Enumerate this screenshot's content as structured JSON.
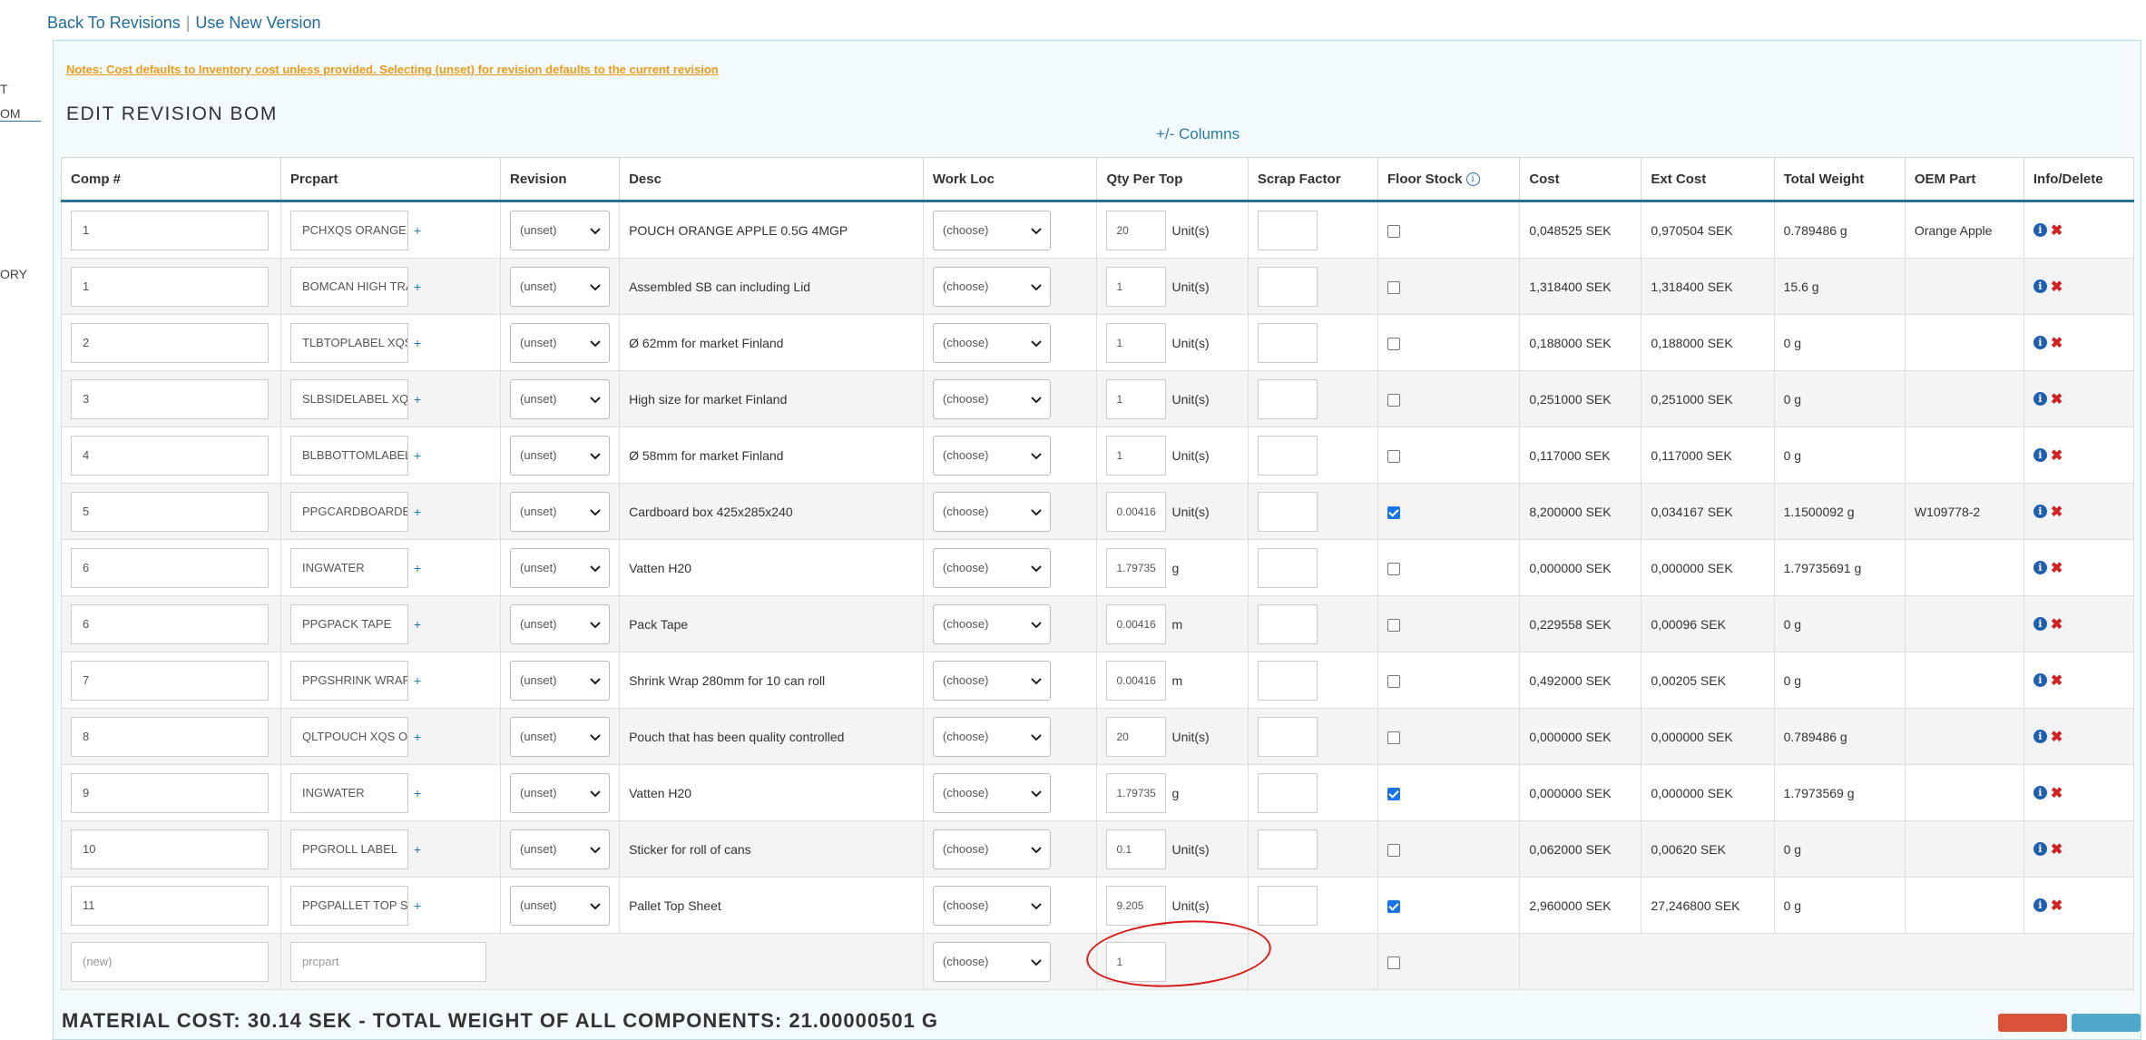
{
  "sidebar": {
    "fragments": [
      "T",
      "OM",
      "ORY"
    ]
  },
  "links": {
    "back": "Back To Revisions",
    "separator": "|",
    "use_new": "Use New Version"
  },
  "notes": "Notes: Cost defaults to Inventory cost unless provided. Selecting (unset) for revision defaults to the current revision",
  "title": "EDIT REVISION BOM",
  "columns_toggle": "+/- Columns",
  "headers": {
    "comp": "Comp #",
    "prcpart": "Prcpart",
    "revision": "Revision",
    "desc": "Desc",
    "workloc": "Work Loc",
    "qty": "Qty Per Top",
    "scrap": "Scrap Factor",
    "floor": "Floor Stock",
    "cost": "Cost",
    "extcost": "Ext Cost",
    "weight": "Total Weight",
    "oem": "OEM Part",
    "info": "Info/Delete"
  },
  "rows": [
    {
      "comp": "1",
      "prcpart": "PCHXQS ORANGE APPLE",
      "revision": "(unset)",
      "desc": "POUCH ORANGE APPLE 0.5G 4MGP",
      "workloc": "(choose)",
      "qty": "20",
      "unit": "Unit(s)",
      "floor": false,
      "cost": "0,048525 SEK",
      "extcost": "0,970504 SEK",
      "weight": "0.789486 g",
      "oem": "Orange Apple"
    },
    {
      "comp": "1",
      "prcpart": "BOMCAN HIGH TRAY",
      "revision": "(unset)",
      "desc": "Assembled SB can including Lid",
      "workloc": "(choose)",
      "qty": "1",
      "unit": "Unit(s)",
      "floor": false,
      "cost": "1,318400 SEK",
      "extcost": "1,318400 SEK",
      "weight": "15.6 g",
      "oem": ""
    },
    {
      "comp": "2",
      "prcpart": "TLBTOPLABEL XQS",
      "revision": "(unset)",
      "desc": "Ø 62mm for market Finland",
      "workloc": "(choose)",
      "qty": "1",
      "unit": "Unit(s)",
      "floor": false,
      "cost": "0,188000 SEK",
      "extcost": "0,188000 SEK",
      "weight": "0 g",
      "oem": ""
    },
    {
      "comp": "3",
      "prcpart": "SLBSIDELABEL XQS",
      "revision": "(unset)",
      "desc": "High size for market Finland",
      "workloc": "(choose)",
      "qty": "1",
      "unit": "Unit(s)",
      "floor": false,
      "cost": "0,251000 SEK",
      "extcost": "0,251000 SEK",
      "weight": "0 g",
      "oem": ""
    },
    {
      "comp": "4",
      "prcpart": "BLBBOTTOMLABEL",
      "revision": "(unset)",
      "desc": "Ø 58mm for market Finland",
      "workloc": "(choose)",
      "qty": "1",
      "unit": "Unit(s)",
      "floor": false,
      "cost": "0,117000 SEK",
      "extcost": "0,117000 SEK",
      "weight": "0 g",
      "oem": ""
    },
    {
      "comp": "5",
      "prcpart": "PPGCARDBOARDBOX",
      "revision": "(unset)",
      "desc": "Cardboard box 425x285x240",
      "workloc": "(choose)",
      "qty": "0.00416",
      "unit": "Unit(s)",
      "floor": true,
      "cost": "8,200000 SEK",
      "extcost": "0,034167 SEK",
      "weight": "1.1500092 g",
      "oem": "W109778-2"
    },
    {
      "comp": "6",
      "prcpart": "INGWATER",
      "revision": "(unset)",
      "desc": "Vatten H20",
      "workloc": "(choose)",
      "qty": "1.79735",
      "unit": "g",
      "floor": false,
      "cost": "0,000000 SEK",
      "extcost": "0,000000 SEK",
      "weight": "1.79735691 g",
      "oem": ""
    },
    {
      "comp": "6",
      "prcpart": "PPGPACK TAPE",
      "revision": "(unset)",
      "desc": "Pack Tape",
      "workloc": "(choose)",
      "qty": "0.00416",
      "unit": "m",
      "floor": false,
      "cost": "0,229558 SEK",
      "extcost": "0,00096 SEK",
      "weight": "0 g",
      "oem": ""
    },
    {
      "comp": "7",
      "prcpart": "PPGSHRINK WRAP FILM",
      "revision": "(unset)",
      "desc": "Shrink Wrap 280mm for 10 can roll",
      "workloc": "(choose)",
      "qty": "0.00416",
      "unit": "m",
      "floor": false,
      "cost": "0,492000 SEK",
      "extcost": "0,00205 SEK",
      "weight": "0 g",
      "oem": ""
    },
    {
      "comp": "8",
      "prcpart": "QLTPOUCH XQS ORANGE",
      "revision": "(unset)",
      "desc": "Pouch that has been quality controlled",
      "workloc": "(choose)",
      "qty": "20",
      "unit": "Unit(s)",
      "floor": false,
      "cost": "0,000000 SEK",
      "extcost": "0,000000 SEK",
      "weight": "0.789486 g",
      "oem": ""
    },
    {
      "comp": "9",
      "prcpart": "INGWATER",
      "revision": "(unset)",
      "desc": "Vatten H20",
      "workloc": "(choose)",
      "qty": "1.79735",
      "unit": "g",
      "floor": true,
      "cost": "0,000000 SEK",
      "extcost": "0,000000 SEK",
      "weight": "1.7973569 g",
      "oem": ""
    },
    {
      "comp": "10",
      "prcpart": "PPGROLL LABEL",
      "revision": "(unset)",
      "desc": "Sticker for roll of cans",
      "workloc": "(choose)",
      "qty": "0.1",
      "unit": "Unit(s)",
      "floor": false,
      "cost": "0,062000 SEK",
      "extcost": "0,00620 SEK",
      "weight": "0 g",
      "oem": ""
    },
    {
      "comp": "11",
      "prcpart": "PPGPALLET TOP SHEET",
      "revision": "(unset)",
      "desc": "Pallet Top Sheet",
      "workloc": "(choose)",
      "qty": "9.205",
      "unit": "Unit(s)",
      "floor": true,
      "cost": "2,960000 SEK",
      "extcost": "27,246800 SEK",
      "weight": "0 g",
      "oem": ""
    }
  ],
  "new_row": {
    "comp_placeholder": "(new)",
    "prcpart_placeholder": "prcpart",
    "workloc": "(choose)",
    "qty": "1"
  },
  "summary": "MATERIAL COST: 30.14 SEK - TOTAL WEIGHT OF ALL COMPONENTS: 21.00000501 G"
}
